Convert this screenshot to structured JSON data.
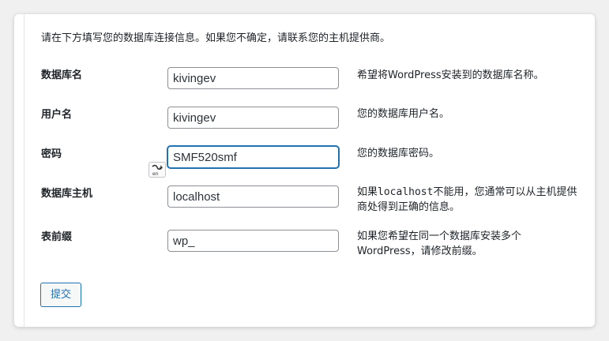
{
  "intro_text": "请在下方填写您的数据库连接信息。如果您不确定，请联系您的主机提供商。",
  "fields": [
    {
      "label": "数据库名",
      "value": "kivingev",
      "description": "希望将WordPress安装到的数据库名称。"
    },
    {
      "label": "用户名",
      "value": "kivingev",
      "description": "您的数据库用户名。"
    },
    {
      "label": "密码",
      "value": "SMF520smf",
      "description": "您的数据库密码。"
    },
    {
      "label": "数据库主机",
      "value": "localhost",
      "description_prefix": "如果",
      "description_code": "localhost",
      "description_suffix": "不能用，您通常可以从主机提供商处得到正确的信息。"
    },
    {
      "label": "表前缀",
      "value": "wp_",
      "description": "如果您希望在同一个数据库安装多个WordPress，请修改前缀。"
    }
  ],
  "submit_label": "提交",
  "ime_icon": "input-method-icon",
  "colors": {
    "accent": "#2271b1",
    "page_bg": "#f0f0f1",
    "card_bg": "#ffffff",
    "text": "#1d2327"
  }
}
